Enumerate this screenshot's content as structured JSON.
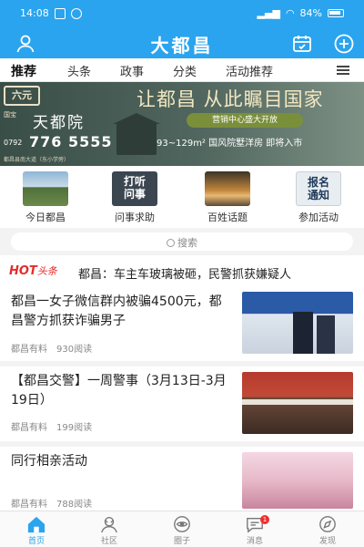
{
  "status_bar": {
    "time": "14:08",
    "battery": "84%"
  },
  "header": {
    "title": "大都昌",
    "user_icon": "user-icon",
    "calendar_icon": "calendar-icon",
    "add_icon": "plus-icon"
  },
  "tabs": [
    {
      "label": "推荐",
      "active": true
    },
    {
      "label": "头条"
    },
    {
      "label": "政事"
    },
    {
      "label": "分类"
    },
    {
      "label": "活动推荐"
    }
  ],
  "banner": {
    "logo": "六元",
    "brand": "天都院",
    "brand_small": "国宝",
    "phone_code": "0792",
    "phone": "776 5555",
    "slogan": "让都昌 从此瞩目国家",
    "open_text": "营销中心盛大开放",
    "info": "93~129m² 国风院墅洋房 即将入市",
    "address": "都昌县南大道（东小学旁）"
  },
  "quick_nav": [
    {
      "label": "今日都昌",
      "icon": "today-image"
    },
    {
      "label": "问事求助",
      "icon": "inquiry-image",
      "img_text": "打听\n问事"
    },
    {
      "label": "百姓话题",
      "icon": "topic-image"
    },
    {
      "label": "参加活动",
      "icon": "event-image",
      "img_text": "报名\n通知"
    }
  ],
  "search": {
    "placeholder": "搜索"
  },
  "hot": {
    "tag": "HOT",
    "tag_sub": "头条",
    "text": "都昌：车主车玻璃被砸，民警抓获嫌疑人"
  },
  "news": [
    {
      "title": "都昌一女子微信群内被骗4500元，都昌警方抓获诈骗男子",
      "source": "都昌有料",
      "reads": "930阅读"
    },
    {
      "title": "【都昌交警】一周警事（3月13日-3月19日）",
      "source": "都昌有料",
      "reads": "199阅读"
    },
    {
      "title": "同行相亲活动",
      "source": "都昌有料",
      "reads": "788阅读"
    }
  ],
  "bottom_nav": [
    {
      "label": "首页",
      "active": true
    },
    {
      "label": "社区"
    },
    {
      "label": "圈子"
    },
    {
      "label": "消息",
      "badge": "1"
    },
    {
      "label": "发现"
    }
  ],
  "colors": {
    "primary": "#2aa4ee",
    "hot": "#e42d2d"
  }
}
